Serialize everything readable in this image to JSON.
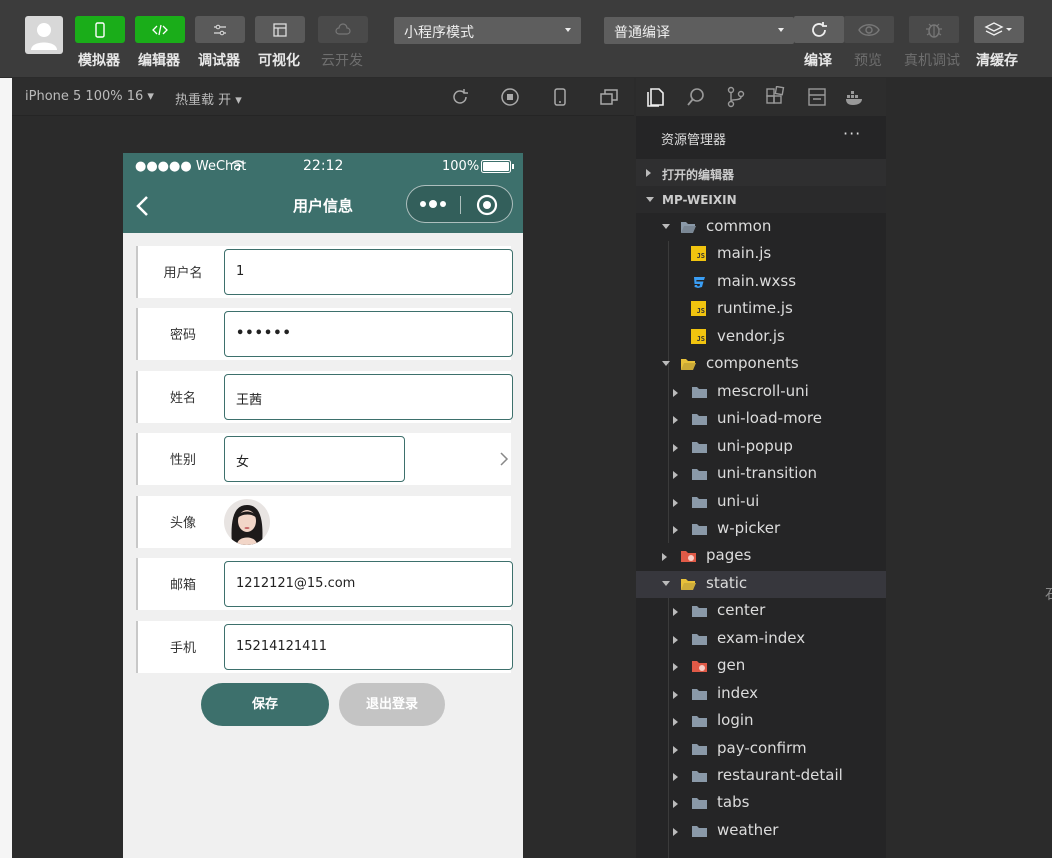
{
  "toolbar": {
    "buttons": [
      {
        "label": "模拟器",
        "icon": "phone-icon",
        "state": "active"
      },
      {
        "label": "编辑器",
        "icon": "code-icon",
        "state": "active"
      },
      {
        "label": "调试器",
        "icon": "sliders-icon",
        "state": "normal"
      },
      {
        "label": "可视化",
        "icon": "layout-icon",
        "state": "normal"
      },
      {
        "label": "云开发",
        "icon": "cloud-icon",
        "state": "disabled"
      }
    ],
    "mode_select": "小程序模式",
    "compile_select": "普通编译",
    "actions": [
      {
        "label": "编译",
        "icon": "refresh-icon",
        "state": "normal"
      },
      {
        "label": "预览",
        "icon": "eye-icon",
        "state": "disabled"
      },
      {
        "label": "真机调试",
        "icon": "bug-icon",
        "state": "disabled"
      },
      {
        "label": "清缓存",
        "icon": "layers-icon",
        "state": "normal"
      }
    ]
  },
  "simulator": {
    "device": "iPhone 5 100% 16",
    "hot_reload": "热重载 开",
    "status_bar": {
      "signal": "●●●●● WeChat",
      "time": "22:12",
      "battery": "100%"
    },
    "nav_title": "用户信息",
    "form": [
      {
        "label": "用户名",
        "value": "1"
      },
      {
        "label": "密码",
        "value": "••••••"
      },
      {
        "label": "姓名",
        "value": "王茜"
      },
      {
        "label": "性别",
        "value": "女"
      },
      {
        "label": "头像",
        "value": ""
      },
      {
        "label": "邮箱",
        "value": "1212121@15.com"
      },
      {
        "label": "手机",
        "value": "15214121411"
      }
    ],
    "save_label": "保存",
    "logout_label": "退出登录"
  },
  "explorer": {
    "title": "资源管理器",
    "more": "···",
    "open_editors": "打开的编辑器",
    "project": "MP-WEIXIN",
    "tree": [
      {
        "name": "common",
        "type": "folder-open",
        "depth": 1
      },
      {
        "name": "main.js",
        "type": "js",
        "depth": 2
      },
      {
        "name": "main.wxss",
        "type": "css",
        "depth": 2
      },
      {
        "name": "runtime.js",
        "type": "js",
        "depth": 2
      },
      {
        "name": "vendor.js",
        "type": "js",
        "depth": 2
      },
      {
        "name": "components",
        "type": "folder-open-special",
        "depth": 1
      },
      {
        "name": "mescroll-uni",
        "type": "folder",
        "depth": 2
      },
      {
        "name": "uni-load-more",
        "type": "folder",
        "depth": 2
      },
      {
        "name": "uni-popup",
        "type": "folder",
        "depth": 2
      },
      {
        "name": "uni-transition",
        "type": "folder",
        "depth": 2
      },
      {
        "name": "uni-ui",
        "type": "folder",
        "depth": 2
      },
      {
        "name": "w-picker",
        "type": "folder",
        "depth": 2
      },
      {
        "name": "pages",
        "type": "folder-red",
        "depth": 1
      },
      {
        "name": "static",
        "type": "folder-open-special",
        "depth": 1
      },
      {
        "name": "center",
        "type": "folder",
        "depth": 2
      },
      {
        "name": "exam-index",
        "type": "folder",
        "depth": 2
      },
      {
        "name": "gen",
        "type": "folder-red",
        "depth": 2
      },
      {
        "name": "index",
        "type": "folder",
        "depth": 2
      },
      {
        "name": "login",
        "type": "folder",
        "depth": 2
      },
      {
        "name": "pay-confirm",
        "type": "folder",
        "depth": 2
      },
      {
        "name": "restaurant-detail",
        "type": "folder",
        "depth": 2
      },
      {
        "name": "tabs",
        "type": "folder",
        "depth": 2
      },
      {
        "name": "weather",
        "type": "folder",
        "depth": 2
      }
    ]
  },
  "edge_text": "石"
}
